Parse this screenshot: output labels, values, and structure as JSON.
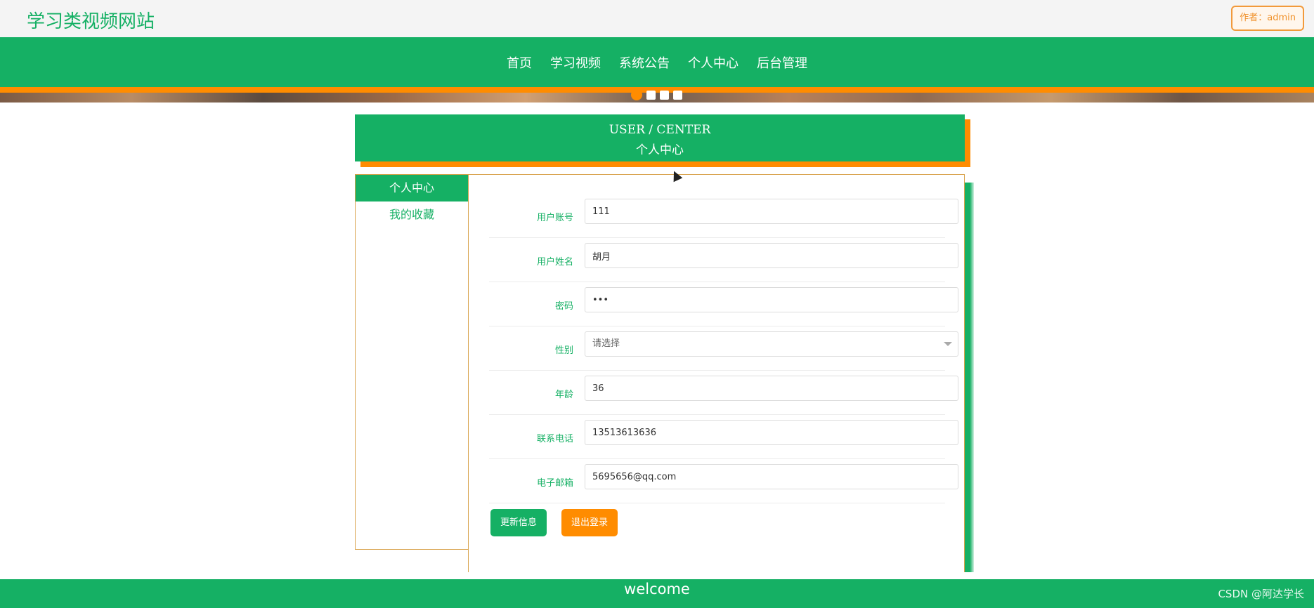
{
  "header": {
    "site_title": "学习类视频网站",
    "author_label": "作者：admin"
  },
  "nav": {
    "items": [
      "首页",
      "学习视频",
      "系统公告",
      "个人中心",
      "后台管理"
    ]
  },
  "carousel": {
    "active_index": 0,
    "count": 4
  },
  "section": {
    "title_en": "USER / CENTER",
    "title_cn": "个人中心"
  },
  "sidebar": {
    "items": [
      {
        "label": "个人中心",
        "active": true
      },
      {
        "label": "我的收藏",
        "active": false
      }
    ]
  },
  "form": {
    "fields": [
      {
        "label": "用户账号",
        "value": "111"
      },
      {
        "label": "用户姓名",
        "value": "胡月"
      },
      {
        "label": "密码",
        "value": "•••"
      },
      {
        "label": "性别",
        "value": "请选择"
      },
      {
        "label": "年龄",
        "value": "36"
      },
      {
        "label": "联系电话",
        "value": "13513613636"
      },
      {
        "label": "电子邮箱",
        "value": "5695656@qq.com"
      }
    ],
    "update_button": "更新信息",
    "logout_button": "退出登录"
  },
  "footer": {
    "text": "welcome",
    "watermark": "CSDN @阿达学长"
  },
  "colors": {
    "primary": "#15b064",
    "accent": "#ff8c00",
    "border": "#d8a24a"
  }
}
